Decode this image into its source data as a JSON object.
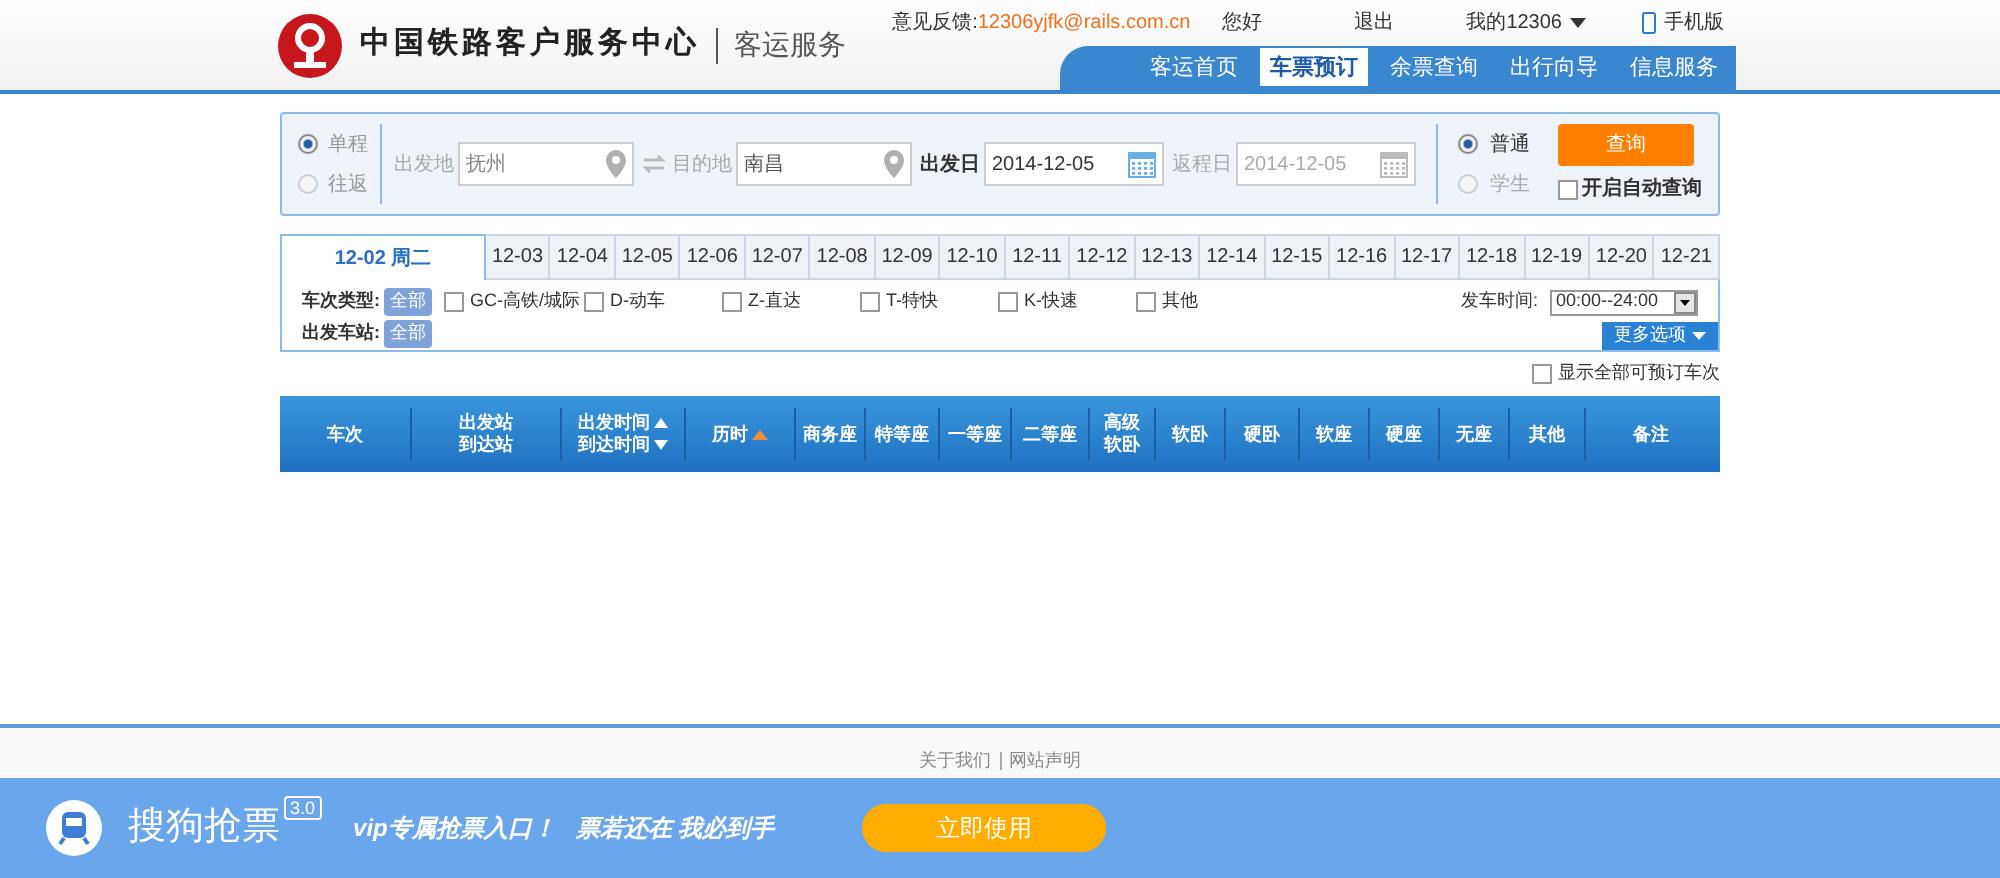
{
  "header": {
    "title": "中国铁路客户服务中心",
    "subtitle": "客运服务",
    "feedback_label": "意见反馈:",
    "feedback_email": "12306yjfk@rails.com.cn",
    "greeting": "您好",
    "logout": "退出",
    "my_account": "我的12306",
    "mobile": "手机版",
    "nav": [
      {
        "label": "客运首页",
        "selected": false
      },
      {
        "label": "车票预订",
        "selected": true
      },
      {
        "label": "余票查询",
        "selected": false
      },
      {
        "label": "出行向导",
        "selected": false
      },
      {
        "label": "信息服务",
        "selected": false
      }
    ]
  },
  "search": {
    "trip_types": [
      {
        "label": "单程",
        "selected": true
      },
      {
        "label": "往返",
        "selected": false
      }
    ],
    "from_label": "出发地",
    "from_value": "抚州",
    "to_label": "目的地",
    "to_value": "南昌",
    "depart_label": "出发日",
    "depart_value": "2014-12-05",
    "return_label": "返程日",
    "return_value": "2014-12-05",
    "passenger_types": [
      {
        "label": "普通",
        "selected": true
      },
      {
        "label": "学生",
        "selected": false
      }
    ],
    "query_button": "查询",
    "auto_query": {
      "label": "开启自动查询",
      "checked": false
    }
  },
  "dates": [
    {
      "label": "12-02 周二",
      "selected": true
    },
    {
      "label": "12-03",
      "selected": false
    },
    {
      "label": "12-04",
      "selected": false
    },
    {
      "label": "12-05",
      "selected": false
    },
    {
      "label": "12-06",
      "selected": false
    },
    {
      "label": "12-07",
      "selected": false
    },
    {
      "label": "12-08",
      "selected": false
    },
    {
      "label": "12-09",
      "selected": false
    },
    {
      "label": "12-10",
      "selected": false
    },
    {
      "label": "12-11",
      "selected": false
    },
    {
      "label": "12-12",
      "selected": false
    },
    {
      "label": "12-13",
      "selected": false
    },
    {
      "label": "12-14",
      "selected": false
    },
    {
      "label": "12-15",
      "selected": false
    },
    {
      "label": "12-16",
      "selected": false
    },
    {
      "label": "12-17",
      "selected": false
    },
    {
      "label": "12-18",
      "selected": false
    },
    {
      "label": "12-19",
      "selected": false
    },
    {
      "label": "12-20",
      "selected": false
    },
    {
      "label": "12-21",
      "selected": false
    }
  ],
  "filters": {
    "train_type_label": "车次类型:",
    "train_type_all": "全部",
    "train_types": [
      {
        "label": "GC-高铁/城际",
        "checked": false
      },
      {
        "label": "D-动车",
        "checked": false
      },
      {
        "label": "Z-直达",
        "checked": false
      },
      {
        "label": "T-特快",
        "checked": false
      },
      {
        "label": "K-快速",
        "checked": false
      },
      {
        "label": "其他",
        "checked": false
      }
    ],
    "time_label": "发车时间:",
    "time_value": "00:00--24:00",
    "station_label": "出发车站:",
    "station_all": "全部",
    "more_options": "更多选项",
    "show_all": {
      "label": "显示全部可预订车次",
      "checked": false
    }
  },
  "table": {
    "columns": [
      {
        "lines": [
          "车次"
        ]
      },
      {
        "lines": [
          "出发站",
          "到达站"
        ]
      },
      {
        "lines": [
          "出发时间",
          "到达时间"
        ],
        "kind": "sortable"
      },
      {
        "lines": [
          "历时"
        ],
        "kind": "sorted"
      },
      {
        "lines": [
          "商务座"
        ]
      },
      {
        "lines": [
          "特等座"
        ]
      },
      {
        "lines": [
          "一等座"
        ]
      },
      {
        "lines": [
          "二等座"
        ]
      },
      {
        "lines": [
          "高级",
          "软卧"
        ]
      },
      {
        "lines": [
          "软卧"
        ]
      },
      {
        "lines": [
          "硬卧"
        ]
      },
      {
        "lines": [
          "软座"
        ]
      },
      {
        "lines": [
          "硬座"
        ]
      },
      {
        "lines": [
          "无座"
        ]
      },
      {
        "lines": [
          "其他"
        ]
      },
      {
        "lines": [
          "备注"
        ]
      }
    ]
  },
  "footer_links": [
    "关于我们",
    "网站声明"
  ],
  "banner": {
    "brand": "搜狗抢票",
    "version": "3.0",
    "slogan_1": "vip专属抢票入口！",
    "slogan_2": "票若还在 我必到手",
    "button": "立即使用"
  }
}
